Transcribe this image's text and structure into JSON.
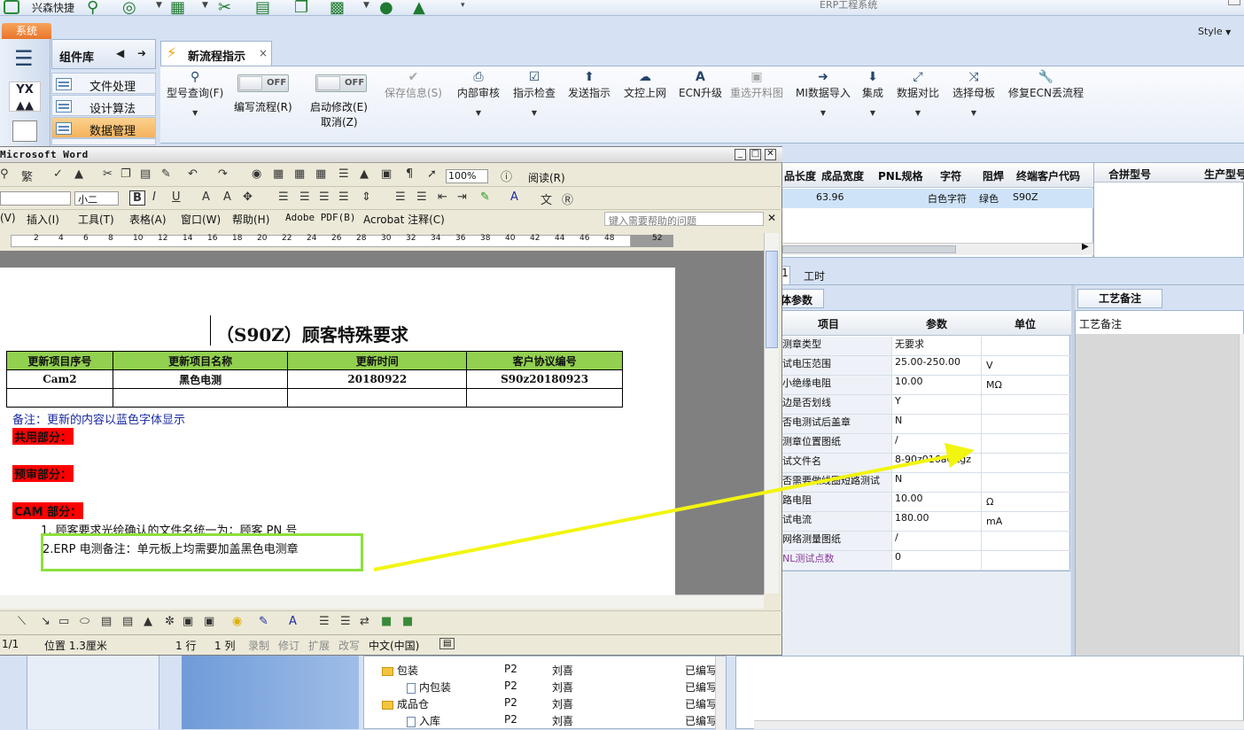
{
  "topbar": {
    "app_name": "兴森快捷",
    "window_title": "ERP工程系统"
  },
  "tabs": {
    "system": "系统",
    "style": "Style"
  },
  "component_library": {
    "title": "组件库",
    "items": [
      "文件处理",
      "设计算法",
      "数据管理"
    ]
  },
  "doc_tab": {
    "title": "新流程指示",
    "close": "×"
  },
  "ribbon": {
    "model_query": "型号查询(F)",
    "edit_flow": "编写流程(R)",
    "off1": "OFF",
    "off2": "OFF",
    "enable_modify": "启动修改(E)",
    "cancel": "取消(Z)",
    "save_info": "保存信息(S)",
    "internal_review": "内部审核",
    "instruction_check": "指示检查",
    "send_instruction": "发送指示",
    "doc_upload": "文控上网",
    "ecn_upgrade": "ECN升级",
    "reselect_material": "重选开料图",
    "mi_import": "MI数据导入",
    "integrate": "集成",
    "data_compare": "数据对比",
    "select_mother": "选择母板",
    "repair_ecn": "修复ECN丢流程"
  },
  "grid_top": {
    "headers": [
      "品长度",
      "成品宽度",
      "PNL规格",
      "字符",
      "阻焊",
      "终端客户代码"
    ],
    "row": [
      "",
      "63.96",
      "",
      "白色字符",
      "绿色",
      "S90Z"
    ],
    "right_headers": [
      "合拼型号",
      "生产型号"
    ]
  },
  "lower_tabs": {
    "selected": "1",
    "work_hours": "工时",
    "params": "体参数",
    "notes_tab": "工艺备注",
    "notes_label": "工艺备注"
  },
  "params_grid": {
    "headers": [
      "项目",
      "参数",
      "单位"
    ],
    "rows": [
      {
        "item": "测章类型",
        "value": "无要求",
        "unit": ""
      },
      {
        "item": "试电压范围",
        "value": "25.00-250.00",
        "unit": "V"
      },
      {
        "item": "小绝缘电阻",
        "value": "10.00",
        "unit": "MΩ"
      },
      {
        "item": "边是否划线",
        "value": "Y",
        "unit": ""
      },
      {
        "item": "否电测试后盖章",
        "value": "N",
        "unit": ""
      },
      {
        "item": "测章位置图纸",
        "value": "/",
        "unit": ""
      },
      {
        "item": "试文件名",
        "value": "8-90z016a0.tgz",
        "unit": ""
      },
      {
        "item": "否需要做线圈短路测试",
        "value": "N",
        "unit": ""
      },
      {
        "item": "路电阻",
        "value": "10.00",
        "unit": "Ω"
      },
      {
        "item": "试电流",
        "value": "180.00",
        "unit": "mA"
      },
      {
        "item": "网络测量图纸",
        "value": "/",
        "unit": ""
      },
      {
        "item": "NL测试点数",
        "value": "0",
        "unit": ""
      }
    ]
  },
  "tree": {
    "rows": [
      {
        "name": "包装",
        "type": "folder",
        "grade": "P2",
        "person": "刘喜",
        "status": "已编写"
      },
      {
        "name": "内包装",
        "type": "page",
        "grade": "P2",
        "person": "刘喜",
        "status": "已编写"
      },
      {
        "name": "成品仓",
        "type": "folder",
        "grade": "P2",
        "person": "刘喜",
        "status": "已编写"
      },
      {
        "name": "入库",
        "type": "page",
        "grade": "P2",
        "person": "刘喜",
        "status": "已编写"
      }
    ]
  },
  "word": {
    "title": "Microsoft Word",
    "toolbar": {
      "trad": "繁",
      "zoom": "100%",
      "read": "阅读(R)",
      "font_size": "小二"
    },
    "menu": [
      "(V)",
      "插入(I)",
      "工具(T)",
      "表格(A)",
      "窗口(W)",
      "帮助(H)",
      "Adobe PDF(B)",
      "Acrobat 注释(C)"
    ],
    "help_placeholder": "键入需要帮助的问题",
    "ruler": [
      "2",
      "4",
      "6",
      "8",
      "10",
      "12",
      "14",
      "16",
      "18",
      "20",
      "22",
      "24",
      "26",
      "28",
      "30",
      "32",
      "34",
      "36",
      "38",
      "40",
      "42",
      "44",
      "46",
      "48",
      "52"
    ],
    "doc_title": "（S90Z）顾客特殊要求",
    "table_headers": [
      "更新项目序号",
      "更新项目名称",
      "更新时间",
      "客户协议编号"
    ],
    "table_row": [
      "Cam2",
      "黑色电测",
      "20180922",
      "S90z20180923"
    ],
    "note": "备注：更新的内容以蓝色字体显示",
    "section1": "共用部分：",
    "section2": "预审部分：",
    "section3": "CAM 部分：",
    "item1": "1. 顾客要求光绘确认的文件名统一为：顾客 PN 号",
    "item2": "2.ERP 电测备注：单元板上均需要加盖黑色电测章",
    "status": {
      "page": "1/1",
      "position": "位置 1.3厘米",
      "line": "1 行",
      "col": "1 列",
      "rec": "录制",
      "rev": "修订",
      "ext": "扩展",
      "ovr": "改写",
      "lang": "中文(中国)"
    }
  },
  "colors": {
    "accent_orange": "#f5b25b",
    "green_header": "#92d050",
    "highlight_red": "#ff0000",
    "annotation_green": "#8de03a",
    "arrow_yellow": "#f2f50f",
    "note_blue": "#1b2ba0"
  }
}
